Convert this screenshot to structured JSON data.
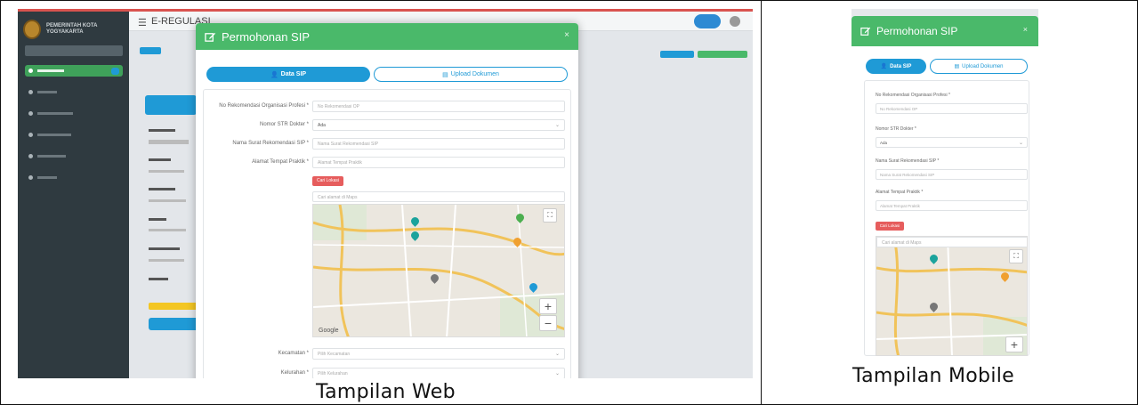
{
  "captions": {
    "web": "Tampilan Web",
    "mobile": "Tampilan Mobile"
  },
  "colors": {
    "accent_green": "#4ab96a",
    "primary_blue": "#1f9ad6",
    "danger_red": "#e65d5d",
    "sidebar": "#2f3a40"
  },
  "web": {
    "app_title": "E-REGULASI",
    "sidebar_brand": "PEMERINTAH KOTA YOGYAKARTA",
    "modal": {
      "icon": "edit-icon",
      "title": "Permohonan SIP",
      "close": "×",
      "tabs": [
        {
          "label": "Data SIP",
          "icon": "user-icon",
          "active": true
        },
        {
          "label": "Upload Dokumen",
          "icon": "document-icon",
          "active": false
        }
      ],
      "fields": [
        {
          "label": "No Rekomendasi Organisasi Profesi *",
          "placeholder": "No Rekomendasi OP"
        },
        {
          "label": "Nomor STR Dokter *",
          "value": "Ada"
        },
        {
          "label": "Nama Surat Rekomendasi SIP *",
          "placeholder": "Nama Surat Rekomendasi SIP"
        },
        {
          "label": "Alamat Tempat Praktik *",
          "placeholder": "Alamat Tempat Praktik"
        }
      ],
      "location_button": "Cari Lokasi",
      "map_search_placeholder": "Cari alamat di Maps",
      "map_footer": "Google",
      "lower_fields": [
        {
          "label": "Kecamatan *",
          "placeholder": "Pilih Kecamatan"
        },
        {
          "label": "Kelurahan *",
          "placeholder": "Pilih Kelurahan"
        }
      ]
    }
  },
  "mobile": {
    "modal": {
      "icon": "edit-icon",
      "title": "Permohonan SIP",
      "close": "×",
      "tabs": [
        {
          "label": "Data SIP",
          "icon": "user-icon",
          "active": true
        },
        {
          "label": "Upload Dokumen",
          "icon": "document-icon",
          "active": false
        }
      ],
      "fields": [
        {
          "label": "No Rekomendasi Organisasi Profesi *",
          "placeholder": "No Rekomendasi OP"
        },
        {
          "label": "Nomor STR Dokter *",
          "value": "Ada"
        },
        {
          "label": "Nama Surat Rekomendasi SIP *",
          "placeholder": "Nama Surat Rekomendasi SIP"
        },
        {
          "label": "Alamat Tempat Praktik *",
          "placeholder": "Alamat Tempat Praktik"
        }
      ],
      "location_button": "Cari Lokasi",
      "map_search_placeholder": "Cari alamat di Maps"
    }
  }
}
